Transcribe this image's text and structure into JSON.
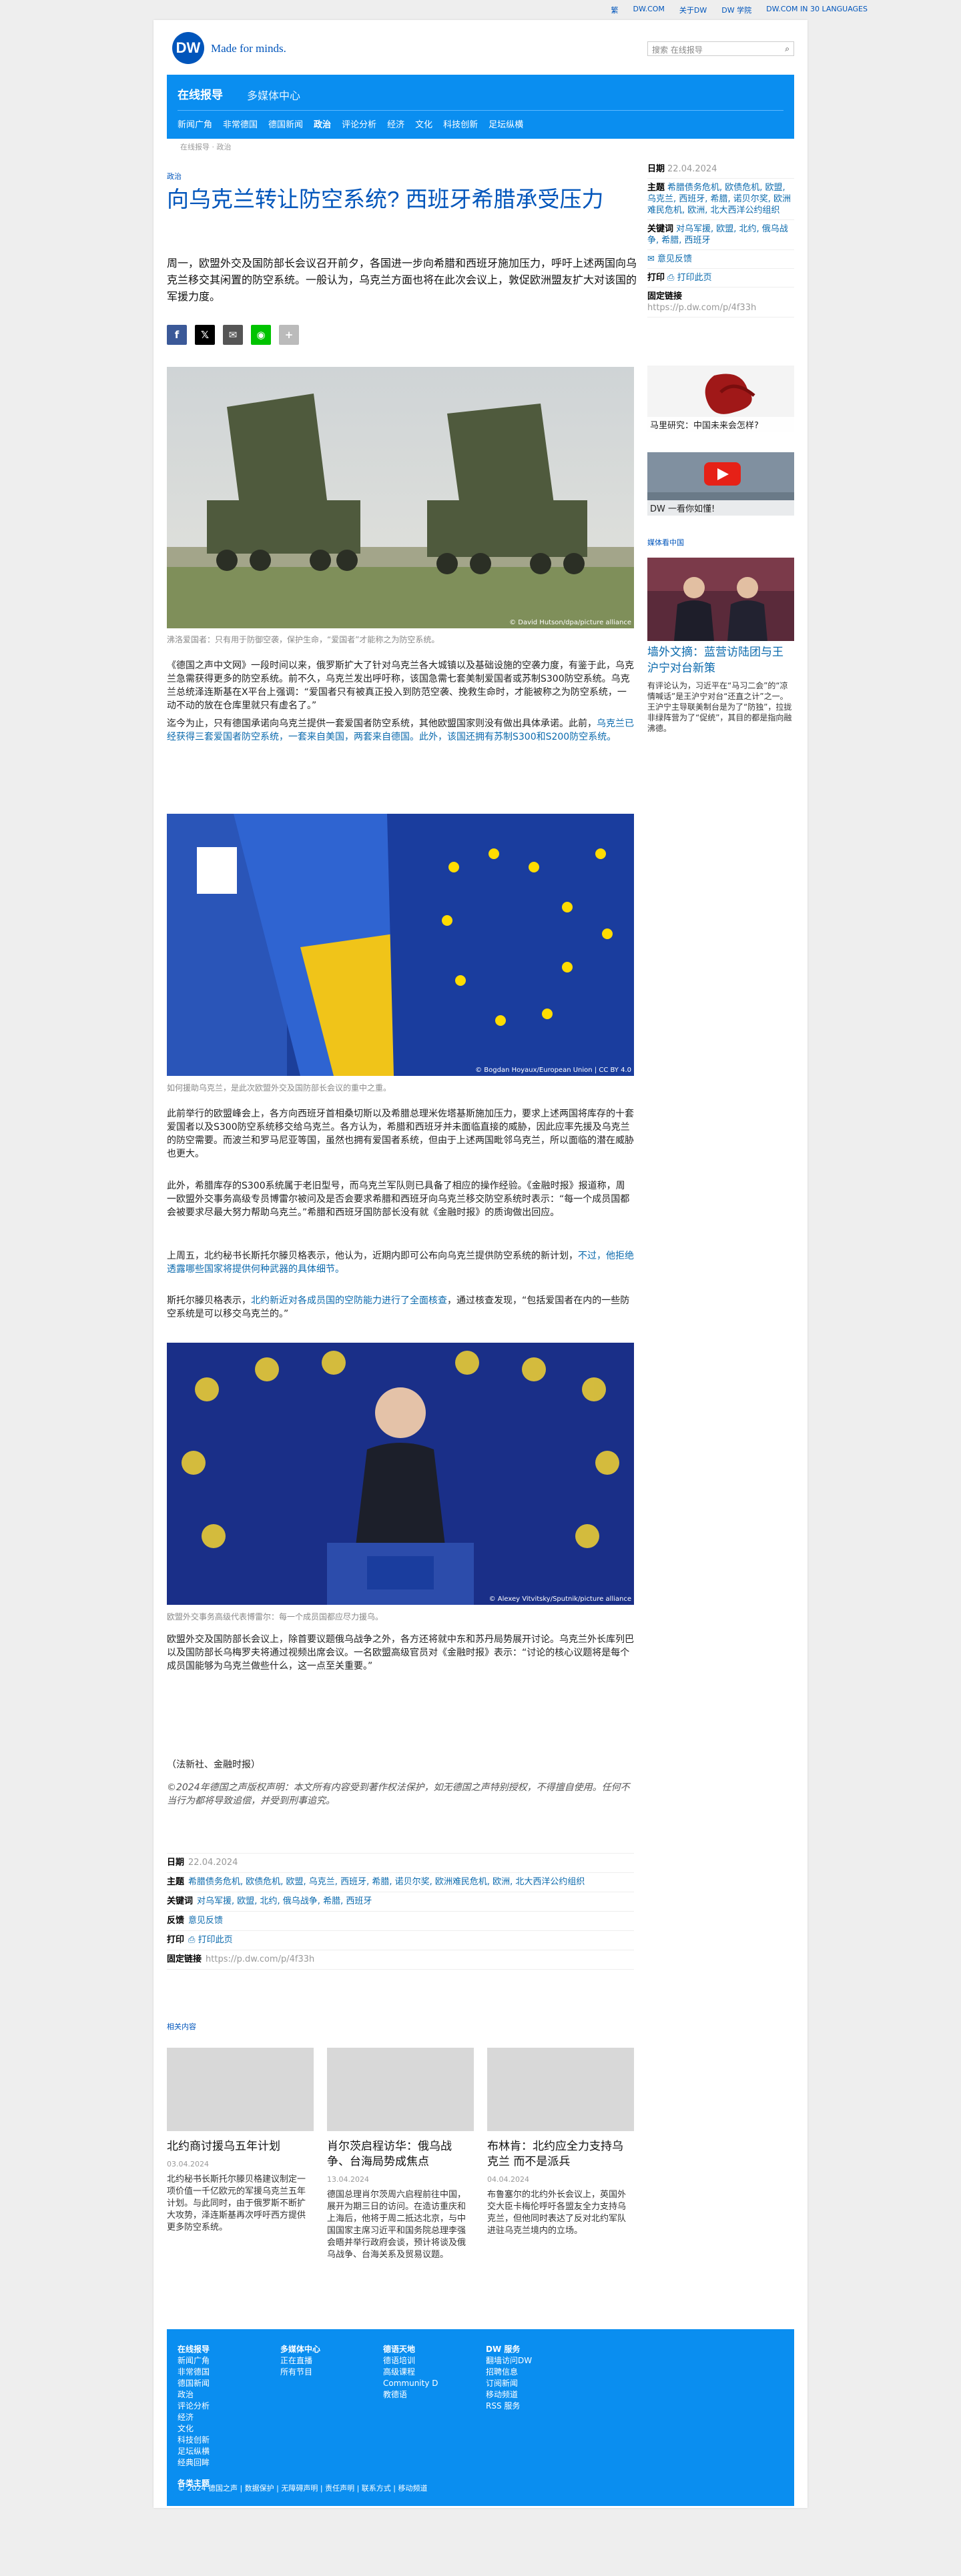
{
  "topbar": {
    "links": [
      "繁",
      "DW.COM",
      "关于DW",
      "DW 学院",
      "DW.COM IN 30 LANGUAGES"
    ]
  },
  "header": {
    "logo": "DW",
    "slogan": "Made for minds.",
    "search_placeholder": "搜索 在线报导"
  },
  "nav": {
    "brand": "在线报导",
    "media": "多媒体中心",
    "menu": [
      "新闻广角",
      "非常德国",
      "德国新闻",
      "政治",
      "评论分析",
      "经济",
      "文化",
      "科技创新",
      "足坛纵横"
    ]
  },
  "breadcrumb": "在线报导 · 政治",
  "article": {
    "category": "政治",
    "title": "向乌克兰转让防空系统? 西班牙希腊承受压力",
    "lead": "周一，欧盟外交及国防部长会议召开前夕，各国进一步向希腊和西班牙施加压力，呼吁上述两国向乌克兰移交其闲置的防空系统。一般认为，乌克兰方面也将在此次会议上，敦促欧洲盟友扩大对该国的军援力度。",
    "share_icons": [
      "facebook-icon",
      "x-icon",
      "email-icon",
      "line-icon",
      "more-icon"
    ],
    "images": [
      {
        "credit": "© David Hutson/dpa/picture alliance",
        "caption": "沸洛爱国者：只有用于防御空袭，保护生命，“爱国者”才能称之为防空系统。"
      },
      {
        "credit": "© Bogdan Hoyaux/European Union | CC BY 4.0",
        "caption": "如何援助乌克兰，是此次欧盟外交及国防部长会议的重中之重。"
      },
      {
        "credit": "© Alexey Vitvitsky/Sputnik/picture alliance",
        "caption": "欧盟外交事务高级代表博雷尔：每一个成员国都应尽力援乌。"
      }
    ],
    "p1": "《德国之声中文网》一段时间以来，俄罗斯扩大了针对乌克兰各大城镇以及基础设施的空袭力度，有鉴于此，乌克兰急需获得更多的防空系统。前不久，乌克兰发出呼吁称，该国急需七套美制爱国者或苏制S300防空系统。乌克兰总统泽连斯基在X平台上强调：“爱国者只有被真正投入到防范空袭、挽救生命时，才能被称之为防空系统，一动不动的放在仓库里就只有虚名了。”",
    "p2a": "迄今为止，只有德国承诺向乌克兰提供一套爱国者防空系统，其他欧盟国家则没有做出具体承诺。此前，",
    "p2link": "乌克兰已经获得三套爱国者防空系统，一套来自美国，两套来自德国。此外，该国还拥有苏制S300和S200防空系统。",
    "p3": "此前举行的欧盟峰会上，各方向西班牙首相桑切斯以及希腊总理米佐塔基斯施加压力，要求上述两国将库存的十套爱国者以及S300防空系统移交给乌克兰。各方认为，希腊和西班牙并未面临直接的威胁，因此应率先援及乌克兰的防空需要。而波兰和罗马尼亚等国，虽然也拥有爱国者系统，但由于上述两国毗邻乌克兰，所以面临的潜在威胁也更大。",
    "p4": "此外，希腊库存的S300系统属于老旧型号，而乌克兰军队则已具备了相应的操作经验。《金融时报》报道称，周一欧盟外交事务高级专员博雷尔被问及是否会要求希腊和西班牙向乌克兰移交防空系统时表示：“每一个成员国都会被要求尽最大努力帮助乌克兰。”希腊和西班牙国防部长没有就《金融时报》的质询做出回应。",
    "p5a": "上周五，北约秘书长斯托尔滕贝格表示，他认为，近期内即可公布向乌克兰提供防空系统的新计划，",
    "p5link": "不过，他拒绝透露哪些国家将提供何种武器的具体细节。",
    "p6a": "斯托尔滕贝格表示，",
    "p6link": "北约新近对各成员国的空防能力进行了全面核查",
    "p6b": "，通过核查发现，“包括爱国者在内的一些防空系统是可以移交乌克兰的。”",
    "p7": "欧盟外交及国防部长会议上，除首要议题俄乌战争之外，各方还将就中东和苏丹局势展开讨论。乌克兰外长库列巴以及国防部长乌梅罗夫将通过视频出席会议。一名欧盟高级官员对《金融时报》表示：“讨论的核心议题将是每个成员国能够为乌克兰做些什么，这一点至关重要。”",
    "note": "（法新社、金融时报）",
    "copyright": "©2024年德国之声版权声明：本文所有内容受到著作权法保护，如无德国之声特别授权，不得擅自使用。任何不当行为都将导致追偿，并受到刑事追究。"
  },
  "meta": {
    "date_label": "日期",
    "date": "22.04.2024",
    "topic_label": "主题",
    "topics": "希腊债务危机, 欧债危机, 欧盟, 乌克兰, 西班牙, 希腊, 诺贝尔奖, 欧洲难民危机, 欧洲, 北大西洋公约组织",
    "keyword_label": "关键词",
    "keywords": "对乌军援, 欧盟, 北约, 俄乌战争, 希腊, 西班牙",
    "feedback_label": "反馈",
    "feedback": "意见反馈",
    "print_label": "打印",
    "print": "打印此页",
    "link_label": "固定链接",
    "link": "https://p.dw.com/p/4f33h"
  },
  "sidebar": {
    "keywords_short": "对乌军援, 欧盟, 北约, 俄乌战争, 希腊, 西班牙",
    "feedback": "意见反馈",
    "print": "打印此页",
    "promo1": "马里研究：中国未来会怎样?",
    "promo2": "DW 一看你如懂!",
    "section": "媒体看中国",
    "story_title": "墙外文摘：蓝营访陆团与王沪宁对台新策",
    "story_text": "有评论认为，习近平在“马习二会”的“凉情喊话”是王沪宁对台“还直之计”之一。王沪宁主导联美制台是为了“防独”，拉拢非绿阵营为了“促统”，其目的都是指向融沸德。"
  },
  "related": {
    "label": "相关内容",
    "cards": [
      {
        "title": "北约商讨援乌五年计划",
        "date": "03.04.2024",
        "text": "北约秘书长斯托尔滕贝格建议制定一项价值一千亿欧元的军援乌克兰五年计划。与此同时，由于俄罗斯不断扩大攻势，泽连斯基再次呼吁西方提供更多防空系统。"
      },
      {
        "title": "肖尔茨启程访华：俄乌战争、台海局势成焦点",
        "date": "13.04.2024",
        "text": "德国总理肖尔茨周六启程前往中国，展开为期三日的访问。在造访重庆和上海后，他将于周二抵达北京，与中国国家主席习近平和国务院总理李强会晤并举行政府会谈，预计将谈及俄乌战争、台海关系及贸易议题。"
      },
      {
        "title": "布林肯：北约应全力支持乌克兰 而不是派兵",
        "date": "04.04.2024",
        "text": "布鲁塞尔的北约外长会议上，英国外交大臣卡梅伦呼吁各盟友全力支持乌克兰，但他同时表达了反对北约军队进驻乌克兰境内的立场。"
      }
    ]
  },
  "footer": {
    "cols": [
      {
        "head": "在线报导",
        "items": [
          "新闻广角",
          "非常德国",
          "德国新闻",
          "政治",
          "评论分析",
          "经济",
          "文化",
          "科技创新",
          "足坛纵横",
          "经典回眸"
        ]
      },
      {
        "head": "多媒体中心",
        "items": [
          "正在直播",
          "所有节目"
        ]
      },
      {
        "head": "德语天地",
        "items": [
          "德语培训",
          "高级课程",
          "Community D",
          "教德语"
        ]
      },
      {
        "head": "DW 服务",
        "items": [
          "翻墙访问DW",
          "招聘信息",
          "订阅新闻",
          "移动频道",
          "RSS 服务"
        ]
      }
    ],
    "topics_link": "各类主题",
    "bottom": "© 2024 德国之声 | 数据保护 | 无障碍声明 | 责任声明 | 联系方式 | 移动频道"
  },
  "colors": {
    "brand": "#0055bb",
    "nav": "#0a8ef0",
    "link": "#0b6aad"
  }
}
